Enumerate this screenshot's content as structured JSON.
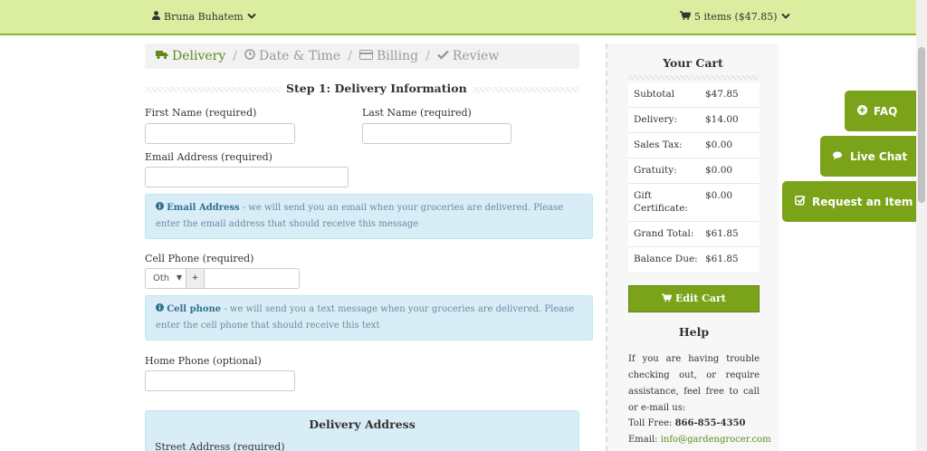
{
  "topbar": {
    "user_name": "Bruna Buhatem",
    "cart_summary": "5 items ($47.85)"
  },
  "steps": [
    {
      "label": "Delivery",
      "icon": "truck-icon",
      "active": true
    },
    {
      "label": "Date & Time",
      "icon": "clock-icon",
      "active": false
    },
    {
      "label": "Billing",
      "icon": "credit-card-icon",
      "active": false
    },
    {
      "label": "Review",
      "icon": "check-icon",
      "active": false
    }
  ],
  "form": {
    "section_title": "Step 1: Delivery Information",
    "first_name_label": "First Name (required)",
    "last_name_label": "Last Name (required)",
    "email_label": "Email Address (required)",
    "email_info_bold": "Email Address",
    "email_info_text": " - we will send you an email when your groceries are delivered. Please enter the email address that should receive this message",
    "cell_label": "Cell Phone (required)",
    "cell_country": "Oth",
    "cell_plus": "+",
    "cell_info_bold": "Cell phone",
    "cell_info_text": " - we will send you a text message when your groceries are delivered. Please enter the cell phone that should receive this text",
    "home_label": "Home Phone (optional)",
    "address_title": "Delivery Address",
    "address_sub": "Street Address (required)"
  },
  "cart": {
    "title": "Your Cart",
    "rows": [
      {
        "k": "Subtotal",
        "v": "$47.85"
      },
      {
        "k": "Delivery:",
        "v": "$14.00"
      },
      {
        "k": "Sales Tax:",
        "v": "$0.00"
      },
      {
        "k": "Gratuity:",
        "v": "$0.00"
      },
      {
        "k": "Gift Certificate:",
        "v": "$0.00"
      },
      {
        "k": "Grand Total:",
        "v": "$61.85"
      },
      {
        "k": "Balance Due:",
        "v": "$61.85"
      }
    ],
    "edit_button": "Edit Cart"
  },
  "help": {
    "title": "Help",
    "text": "If you are having trouble checking out, or require assistance, feel free to call or e-mail us:",
    "toll_label": "Toll Free: ",
    "toll_number": "866-855-4350",
    "email_label": "Email: ",
    "email": "info@gardengrocer.com"
  },
  "floating": {
    "faq": "FAQ",
    "live_chat": "Live Chat",
    "request_item": "Request an Item"
  },
  "colors": {
    "topbar_bg": "#dbee9f",
    "accent_green": "#7aa31a",
    "info_bg": "#d9edf7"
  }
}
